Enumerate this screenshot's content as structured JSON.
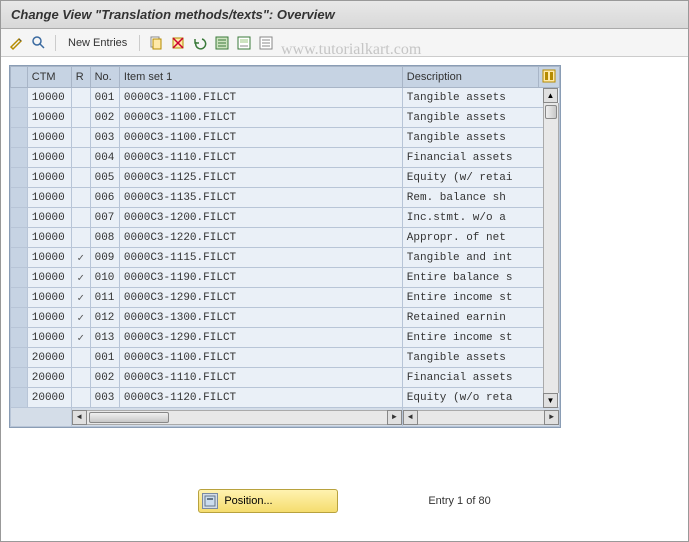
{
  "title": "Change View \"Translation methods/texts\": Overview",
  "watermark": "www.tutorialkart.com",
  "toolbar": {
    "new_entries": "New Entries"
  },
  "headers": {
    "ctm": "CTM",
    "r": "R",
    "no": "No.",
    "item_set": "Item set 1",
    "description": "Description"
  },
  "rows": [
    {
      "ctm": "10000",
      "r": false,
      "no": "001",
      "item": "0000C3-1100.FILCT",
      "desc": "Tangible assets"
    },
    {
      "ctm": "10000",
      "r": false,
      "no": "002",
      "item": "0000C3-1100.FILCT",
      "desc": "Tangible assets"
    },
    {
      "ctm": "10000",
      "r": false,
      "no": "003",
      "item": "0000C3-1100.FILCT",
      "desc": "Tangible assets"
    },
    {
      "ctm": "10000",
      "r": false,
      "no": "004",
      "item": "0000C3-1110.FILCT",
      "desc": "Financial assets"
    },
    {
      "ctm": "10000",
      "r": false,
      "no": "005",
      "item": "0000C3-1125.FILCT",
      "desc": "Equity (w/ retai"
    },
    {
      "ctm": "10000",
      "r": false,
      "no": "006",
      "item": "0000C3-1135.FILCT",
      "desc": "Rem. balance sh"
    },
    {
      "ctm": "10000",
      "r": false,
      "no": "007",
      "item": "0000C3-1200.FILCT",
      "desc": "Inc.stmt. w/o a"
    },
    {
      "ctm": "10000",
      "r": false,
      "no": "008",
      "item": "0000C3-1220.FILCT",
      "desc": "Appropr. of net"
    },
    {
      "ctm": "10000",
      "r": true,
      "no": "009",
      "item": "0000C3-1115.FILCT",
      "desc": "Tangible and int"
    },
    {
      "ctm": "10000",
      "r": true,
      "no": "010",
      "item": "0000C3-1190.FILCT",
      "desc": "Entire balance s"
    },
    {
      "ctm": "10000",
      "r": true,
      "no": "011",
      "item": "0000C3-1290.FILCT",
      "desc": "Entire income st"
    },
    {
      "ctm": "10000",
      "r": true,
      "no": "012",
      "item": "0000C3-1300.FILCT",
      "desc": "Retained earnin"
    },
    {
      "ctm": "10000",
      "r": true,
      "no": "013",
      "item": "0000C3-1290.FILCT",
      "desc": "Entire income st"
    },
    {
      "ctm": "20000",
      "r": false,
      "no": "001",
      "item": "0000C3-1100.FILCT",
      "desc": "Tangible assets"
    },
    {
      "ctm": "20000",
      "r": false,
      "no": "002",
      "item": "0000C3-1110.FILCT",
      "desc": "Financial assets"
    },
    {
      "ctm": "20000",
      "r": false,
      "no": "003",
      "item": "0000C3-1120.FILCT",
      "desc": "Equity (w/o reta"
    }
  ],
  "footer": {
    "position_label": "Position...",
    "entry_text": "Entry 1 of 80"
  }
}
